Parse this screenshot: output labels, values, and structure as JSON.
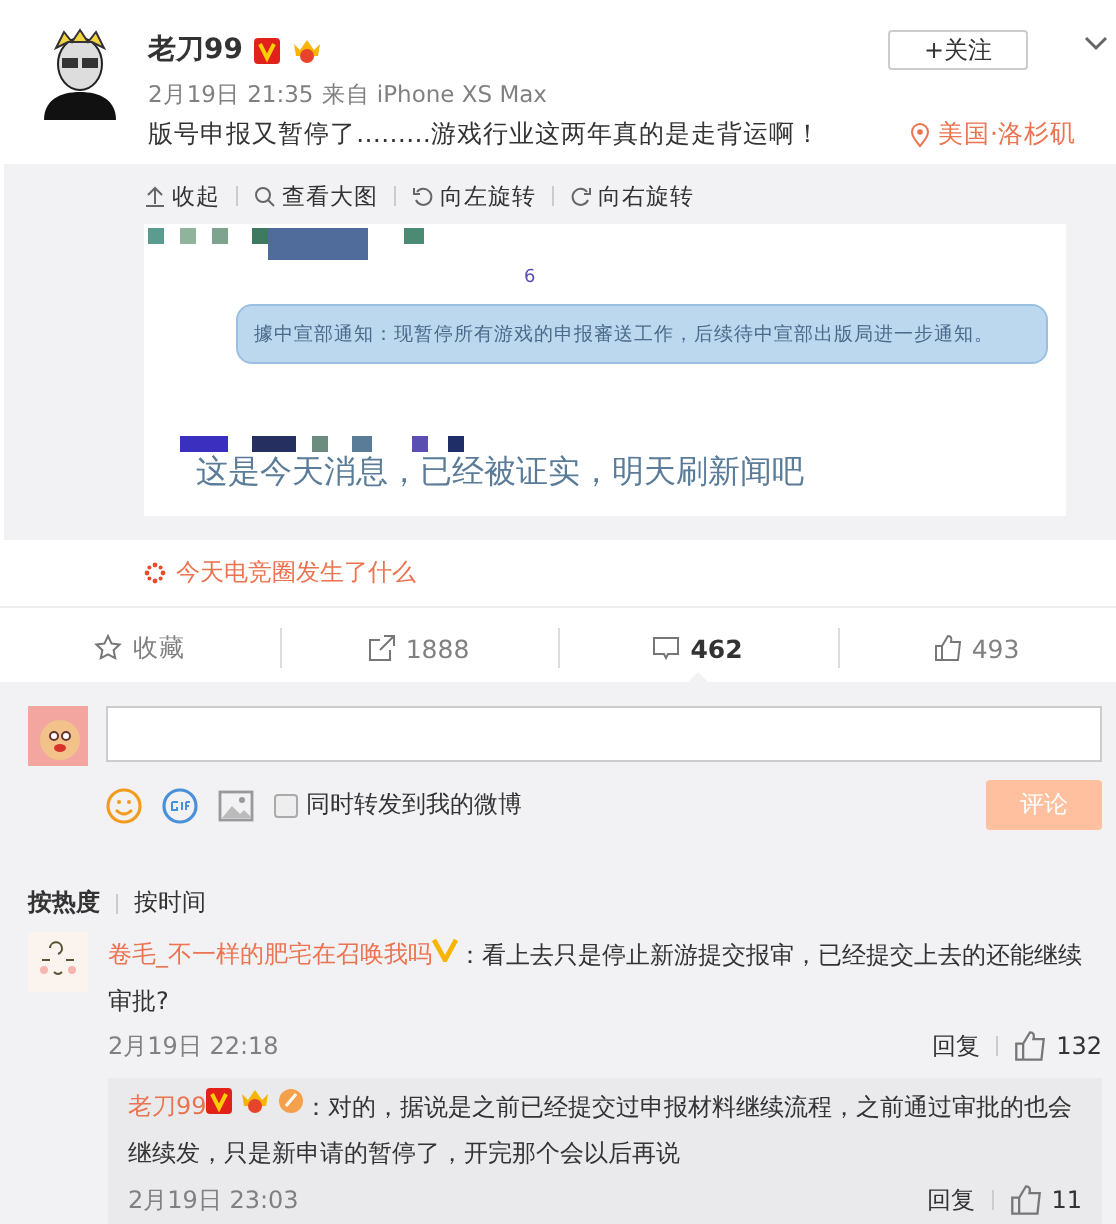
{
  "post": {
    "author": "老刀99",
    "time": "2月19日 21:35",
    "source": "来自 iPhone XS Max",
    "text": "版号申报又暂停了………游戏行业这两年真的是走背运啊！",
    "location": "美国·洛杉矶",
    "follow": "+关注"
  },
  "image_toolbar": [
    {
      "kind": "collapse",
      "label": "收起"
    },
    {
      "kind": "zoom",
      "label": "查看大图"
    },
    {
      "kind": "rotate-left",
      "label": "向左旋转"
    },
    {
      "kind": "rotate-right",
      "label": "向右旋转"
    }
  ],
  "image": {
    "bubble": "據中宣部通知：现暂停所有游戏的申报審送工作，后续待中宣部出版局进一步通知。",
    "caption": "这是今天消息，已经被证实，明天刷新闻吧",
    "mark": "6"
  },
  "topic": "今天电竞圈发生了什么",
  "actions": [
    {
      "kind": "favorite",
      "label": "收藏",
      "selected": false
    },
    {
      "kind": "repost",
      "label": "1888",
      "selected": false
    },
    {
      "kind": "comment",
      "label": "462",
      "selected": true
    },
    {
      "kind": "like",
      "label": "493",
      "selected": false
    }
  ],
  "composer": {
    "repost_label": "同时转发到我的微博",
    "repost_checked": false,
    "submit": "评论",
    "submit_disabled": true
  },
  "sort": [
    {
      "label": "按热度",
      "selected": true
    },
    {
      "label": "按时间",
      "selected": false
    }
  ],
  "comments": [
    {
      "author": "卷毛_不一样的肥宅在召唤我吗",
      "text": "：看上去只是停止新游提交报审，已经提交上去的还能继续审批?",
      "time": "2月19日 22:18",
      "reply": "回复",
      "likes": "132",
      "replies": [
        {
          "author": "老刀99",
          "text": "：对的，据说是之前已经提交过申报材料继续流程，之前通过审批的也会继续发，只是新申请的暂停了，开完那个会以后再说",
          "time": "2月19日 23:03",
          "reply": "回复",
          "likes": "11"
        }
      ]
    }
  ]
}
